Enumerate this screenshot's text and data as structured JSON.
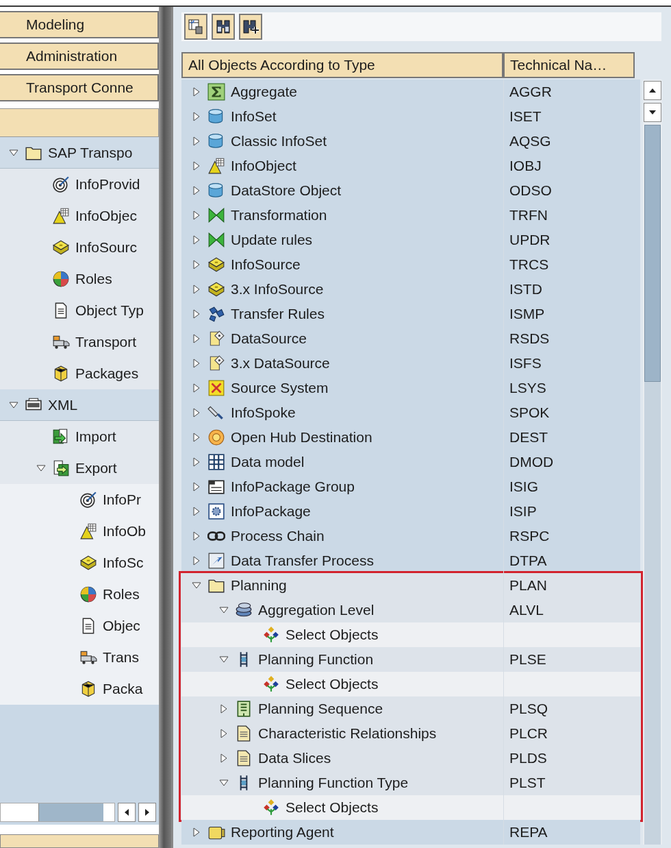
{
  "workbench_nav": [
    {
      "label": "Modeling"
    },
    {
      "label": "Administration"
    },
    {
      "label": "Transport Conne"
    }
  ],
  "left_tree": [
    {
      "label": "SAP Transpo",
      "kind": "folder",
      "expanded": true,
      "children": [
        {
          "label": "InfoProvid",
          "kind": "infoprovider"
        },
        {
          "label": "InfoObjec",
          "kind": "infoobject"
        },
        {
          "label": "InfoSourc",
          "kind": "infosource"
        },
        {
          "label": "Roles",
          "kind": "roles"
        },
        {
          "label": "Object Typ",
          "kind": "objecttype"
        },
        {
          "label": "Transport",
          "kind": "transport"
        },
        {
          "label": "Packages",
          "kind": "packages"
        }
      ]
    },
    {
      "label": "XML",
      "kind": "xml",
      "expanded": true,
      "children": [
        {
          "label": "Import",
          "kind": "import"
        },
        {
          "label": "Export",
          "kind": "export",
          "expanded": true,
          "children": [
            {
              "label": "InfoPr",
              "kind": "infoprovider"
            },
            {
              "label": "InfoOb",
              "kind": "infoobject"
            },
            {
              "label": "InfoSc",
              "kind": "infosource"
            },
            {
              "label": "Roles",
              "kind": "roles"
            },
            {
              "label": "Objec",
              "kind": "objecttype"
            },
            {
              "label": "Trans",
              "kind": "transport"
            },
            {
              "label": "Packa",
              "kind": "packages"
            }
          ]
        }
      ]
    }
  ],
  "toolbar": [
    {
      "kind": "layout"
    },
    {
      "kind": "find"
    },
    {
      "kind": "findnext"
    }
  ],
  "table": {
    "columns": [
      "All Objects According to Type",
      "Technical Na…"
    ],
    "rows": [
      {
        "label": "Aggregate",
        "code": "AGGR",
        "kind": "aggregate",
        "expanded": false,
        "highlighted": false
      },
      {
        "label": "InfoSet",
        "code": "ISET",
        "kind": "infoset",
        "expanded": false,
        "highlighted": false
      },
      {
        "label": "Classic InfoSet",
        "code": "AQSG",
        "kind": "classicinfoset",
        "expanded": false,
        "highlighted": false
      },
      {
        "label": "InfoObject",
        "code": "IOBJ",
        "kind": "infoobject",
        "expanded": false,
        "highlighted": false
      },
      {
        "label": "DataStore Object",
        "code": "ODSO",
        "kind": "datastore",
        "expanded": false,
        "highlighted": false
      },
      {
        "label": "Transformation",
        "code": "TRFN",
        "kind": "transformation",
        "expanded": false,
        "highlighted": false
      },
      {
        "label": "Update rules",
        "code": "UPDR",
        "kind": "updaterules",
        "expanded": false,
        "highlighted": false
      },
      {
        "label": "InfoSource",
        "code": "TRCS",
        "kind": "infosource",
        "expanded": false,
        "highlighted": false
      },
      {
        "label": "3.x InfoSource",
        "code": "ISTD",
        "kind": "infosource",
        "expanded": false,
        "highlighted": false
      },
      {
        "label": "Transfer Rules",
        "code": "ISMP",
        "kind": "transferrules",
        "expanded": false,
        "highlighted": false
      },
      {
        "label": "DataSource",
        "code": "RSDS",
        "kind": "datasource",
        "expanded": false,
        "highlighted": false
      },
      {
        "label": "3.x DataSource",
        "code": "ISFS",
        "kind": "datasource",
        "expanded": false,
        "highlighted": false
      },
      {
        "label": "Source System",
        "code": "LSYS",
        "kind": "sourcesystem",
        "expanded": false,
        "highlighted": false
      },
      {
        "label": "InfoSpoke",
        "code": "SPOK",
        "kind": "infospoke",
        "expanded": false,
        "highlighted": false
      },
      {
        "label": "Open Hub Destination",
        "code": "DEST",
        "kind": "openhub",
        "expanded": false,
        "highlighted": false
      },
      {
        "label": "Data model",
        "code": "DMOD",
        "kind": "datamodel",
        "expanded": false,
        "highlighted": false
      },
      {
        "label": "InfoPackage Group",
        "code": "ISIG",
        "kind": "packagegroup",
        "expanded": false,
        "highlighted": false
      },
      {
        "label": "InfoPackage",
        "code": "ISIP",
        "kind": "infopackage",
        "expanded": false,
        "highlighted": false
      },
      {
        "label": "Process Chain",
        "code": "RSPC",
        "kind": "processchain",
        "expanded": false,
        "highlighted": false
      },
      {
        "label": "Data Transfer Process",
        "code": "DTPA",
        "kind": "dtp",
        "expanded": false,
        "highlighted": false
      },
      {
        "label": "Planning",
        "code": "PLAN",
        "kind": "folder",
        "expanded": true,
        "highlighted": true,
        "children": [
          {
            "label": "Aggregation Level",
            "code": "ALVL",
            "kind": "aggregationlevel",
            "expanded": true,
            "children": [
              {
                "label": "Select Objects",
                "kind": "selection"
              }
            ]
          },
          {
            "label": "Planning Function",
            "code": "PLSE",
            "kind": "planningfunction",
            "expanded": true,
            "children": [
              {
                "label": "Select Objects",
                "kind": "selection"
              }
            ]
          },
          {
            "label": "Planning Sequence",
            "code": "PLSQ",
            "kind": "planningsequence",
            "expanded": false
          },
          {
            "label": "Characteristic Relationships",
            "code": "PLCR",
            "kind": "document",
            "expanded": false
          },
          {
            "label": "Data Slices",
            "code": "PLDS",
            "kind": "document",
            "expanded": false
          },
          {
            "label": "Planning Function Type",
            "code": "PLST",
            "kind": "functiontype",
            "expanded": true,
            "children": [
              {
                "label": "Select Objects",
                "kind": "selection"
              }
            ]
          }
        ]
      },
      {
        "label": "Reporting Agent",
        "code": "REPA",
        "kind": "reportingagent",
        "expanded": false,
        "highlighted": false
      }
    ]
  }
}
